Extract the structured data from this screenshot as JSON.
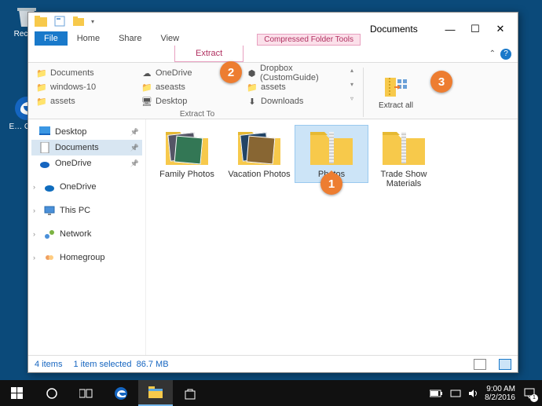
{
  "desktop": {
    "recycle_label": "Recy…",
    "edge_label": "E… Gui…"
  },
  "window": {
    "title": "Documents",
    "context_tools_label": "Compressed Folder Tools",
    "tabs": {
      "file": "File",
      "home": "Home",
      "share": "Share",
      "view": "View",
      "extract": "Extract"
    },
    "ribbon": {
      "group_label": "Extract To",
      "destinations": [
        "Documents",
        "OneDrive",
        "Dropbox (CustomGuide)",
        "windows-10",
        "aseasts",
        "assets",
        "assets",
        "Desktop",
        "Downloads"
      ],
      "extract_all_label": "Extract all"
    }
  },
  "nav": {
    "quick": [
      {
        "label": "Desktop",
        "icon": "desktop",
        "pinned": true
      },
      {
        "label": "Documents",
        "icon": "doc",
        "pinned": true,
        "selected": true
      },
      {
        "label": "OneDrive",
        "icon": "onedrive",
        "pinned": true
      }
    ],
    "tree": [
      {
        "label": "OneDrive",
        "icon": "onedrive"
      },
      {
        "label": "This PC",
        "icon": "pc"
      },
      {
        "label": "Network",
        "icon": "network"
      },
      {
        "label": "Homegroup",
        "icon": "homegroup"
      }
    ]
  },
  "content": {
    "items": [
      {
        "label": "Family Photos",
        "kind": "photo-folder"
      },
      {
        "label": "Vacation Photos",
        "kind": "photo-folder"
      },
      {
        "label": "Photos",
        "kind": "zip",
        "selected": true
      },
      {
        "label": "Trade Show Materials",
        "kind": "zip"
      }
    ]
  },
  "statusbar": {
    "count": "4 items",
    "selection": "1 item selected",
    "size": "86.7 MB"
  },
  "callouts": {
    "c1": "1",
    "c2": "2",
    "c3": "3"
  },
  "taskbar": {
    "time": "9:00 AM",
    "date": "8/2/2016",
    "notif_count": "1"
  }
}
